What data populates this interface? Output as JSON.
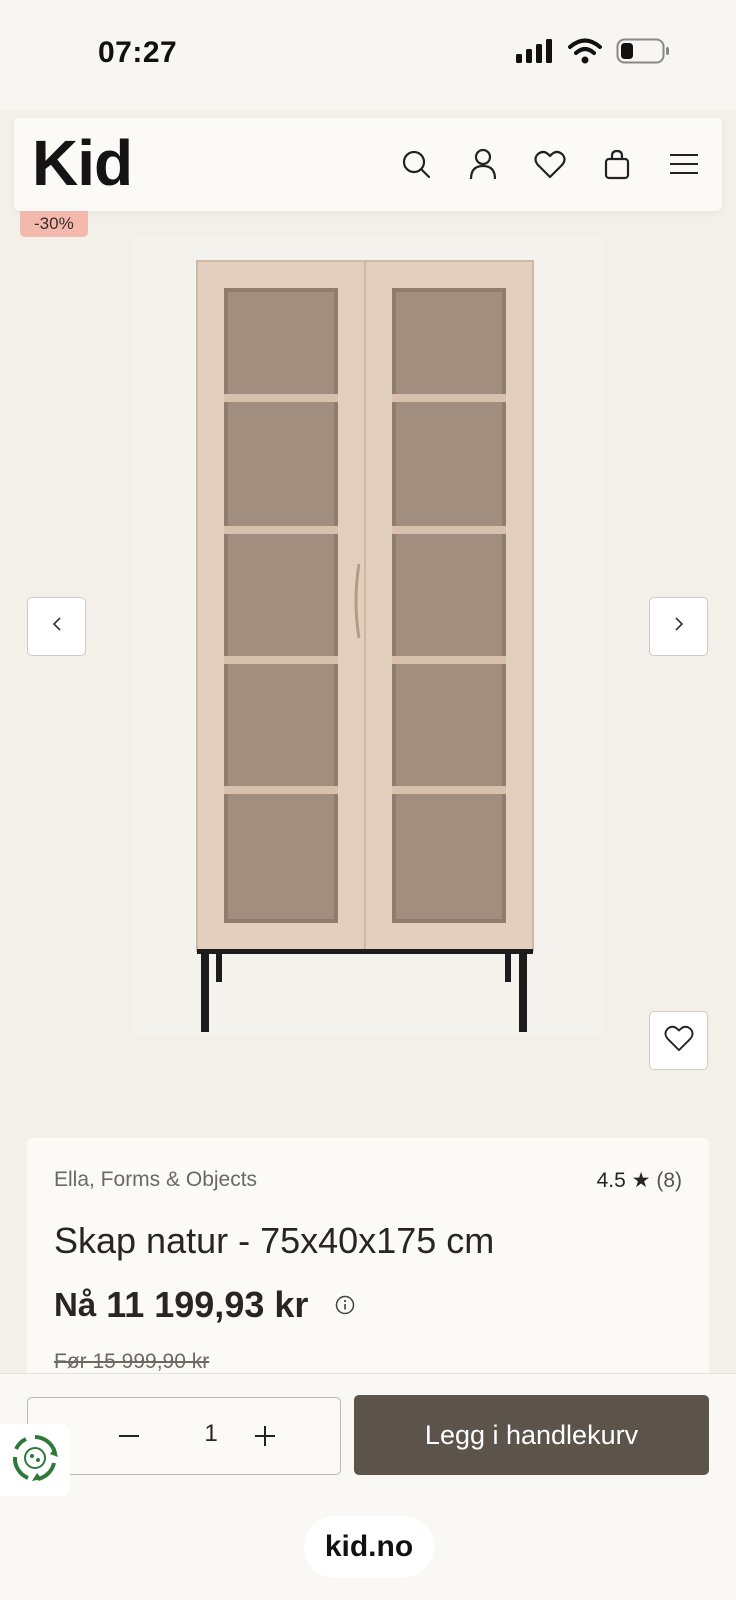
{
  "status_bar": {
    "time": "07:27"
  },
  "header": {
    "logo": "Kid",
    "icons": [
      "search-icon",
      "account-icon",
      "heart-icon",
      "bag-icon",
      "menu-icon"
    ]
  },
  "gallery": {
    "discount_badge": "-30%",
    "prev_glyph": "‹",
    "next_glyph": "›"
  },
  "product": {
    "brand": "Ella, Forms & Objects",
    "rating_value": "4.5",
    "rating_star": "★",
    "rating_count": "(8)",
    "title": "Skap natur - 75x40x175 cm",
    "price_prefix": "Nå",
    "price": "11 199,93 kr",
    "old_price": "Før 15 999,90 kr"
  },
  "cart": {
    "quantity": "1",
    "add_to_cart_label": "Legg i handlekurv"
  },
  "browser": {
    "domain": "kid.no"
  },
  "colors": {
    "accent_button": "#5c534b",
    "badge": "#f4b9ad",
    "background": "#f3f0ea"
  }
}
